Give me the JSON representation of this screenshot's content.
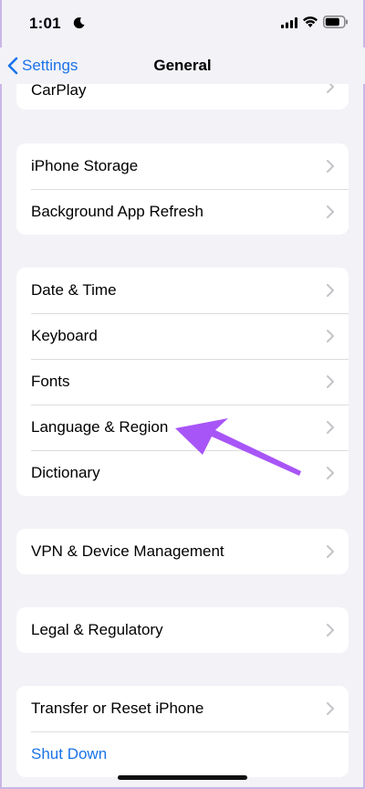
{
  "status_bar": {
    "time": "1:01"
  },
  "nav": {
    "back_label": "Settings",
    "title": "General"
  },
  "groups": {
    "top_partial": [
      "CarPlay"
    ],
    "storage": [
      "iPhone Storage",
      "Background App Refresh"
    ],
    "regional": [
      "Date & Time",
      "Keyboard",
      "Fonts",
      "Language & Region",
      "Dictionary"
    ],
    "vpn": [
      "VPN & Device Management"
    ],
    "legal": [
      "Legal & Regulatory"
    ],
    "reset": [
      "Transfer or Reset iPhone",
      "Shut Down"
    ]
  },
  "colors": {
    "accent": "#1a73e8",
    "annotation_arrow": "#a855f7",
    "background": "#f2f2f7"
  }
}
